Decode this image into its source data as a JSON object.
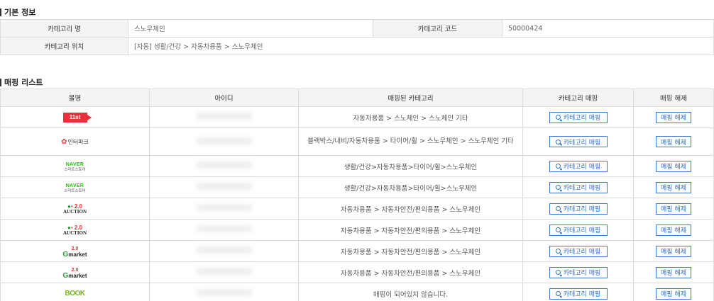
{
  "basic_info": {
    "title": "기본 정보",
    "category_name_label": "카테고리 명",
    "category_name_value": "스노우체인",
    "category_code_label": "카테고리 코드",
    "category_code_value": "50000424",
    "category_location_label": "카테고리 위치",
    "category_location_value": "[자동] 생활/건강 > 자동차용품 > 스노우체인"
  },
  "mapping_list": {
    "title": "매핑 리스트",
    "headers": {
      "mall": "몰명",
      "id": "아이디",
      "mapped_category": "매핑된 카테고리",
      "category_mapping": "카테고리 매핑",
      "unmap": "매핑 해제"
    },
    "map_button_label": "카테고리 매핑",
    "unmap_button_label": "매핑 해제",
    "rows": [
      {
        "mall": "11st",
        "logo_text": "11st",
        "category": "자동차용품 > 스노체인 > 스노체인 기타"
      },
      {
        "mall": "interpark",
        "logo_text": "인터파크",
        "category": "블랙박스/내비/자동차용품 > 타이어/휠 > 스노우체인 > 스노우체인 기타"
      },
      {
        "mall": "naver",
        "logo_text": "NAVER",
        "logo_sub": "스마트스토어",
        "category": "생활/건강>자동차용품>타이어/휠>스노우체인"
      },
      {
        "mall": "naver",
        "logo_text": "NAVER",
        "logo_sub": "스마트스토어",
        "category": "생활/건강>자동차용품>타이어/휠>스노우체인"
      },
      {
        "mall": "auction",
        "logo_text": "AUCTION",
        "logo_ver": "2.0",
        "category": "자동차용품 > 자동차안전/편의용품 > 스노우체인"
      },
      {
        "mall": "auction",
        "logo_text": "AUCTION",
        "logo_ver": "2.0",
        "category": "자동차용품 > 자동차안전/편의용품 > 스노우체인"
      },
      {
        "mall": "gmarket",
        "logo_text": "market",
        "logo_ver": "2.0",
        "category": "자동차용품 > 자동차안전/편의용품 > 스노우체인"
      },
      {
        "mall": "gmarket",
        "logo_text": "market",
        "logo_ver": "2.0",
        "category": "자동차용품 > 자동차안전/편의용품 > 스노우체인"
      },
      {
        "mall": "book",
        "logo_text": "BOOK",
        "category": "매핑이 되어있지 않습니다."
      }
    ]
  },
  "colors": {
    "button_border": "#3b7bd4",
    "unmapped_text": "#e02020",
    "header_bg": "#f4f4f4"
  }
}
